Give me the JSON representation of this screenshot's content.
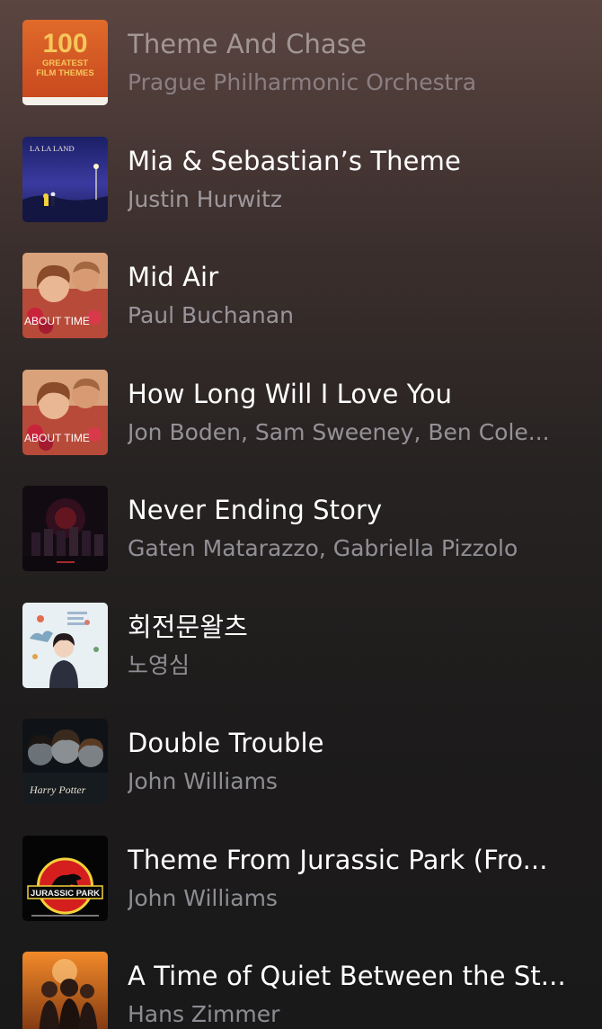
{
  "songs": [
    {
      "title": "Theme And Chase",
      "artist": "Prague Philharmonic Orchestra",
      "art": "100-greatest-film-themes-cover",
      "art_text": [
        "100",
        "GREATEST",
        "FILM THEMES"
      ],
      "dimmed": true
    },
    {
      "title": "Mia & Sebastian’s Theme",
      "artist": "Justin Hurwitz",
      "art": "la-la-land-cover",
      "art_text": [
        "LA LA LAND"
      ],
      "dimmed": false
    },
    {
      "title": "Mid Air",
      "artist": "Paul Buchanan",
      "art": "about-time-cover",
      "art_text": [
        "ABOUT TIME"
      ],
      "dimmed": false
    },
    {
      "title": "How Long Will I Love You",
      "artist": "Jon Boden, Sam Sweeney, Ben Cole...",
      "art": "about-time-cover",
      "art_text": [
        "ABOUT TIME"
      ],
      "dimmed": false
    },
    {
      "title": "Never Ending Story",
      "artist": "Gaten Matarazzo, Gabriella Pizzolo",
      "art": "stranger-things-cover",
      "art_text": [],
      "dimmed": false
    },
    {
      "title": "회전문왈츠",
      "artist": "노영심",
      "art": "korean-drama-ost-cover",
      "art_text": [],
      "dimmed": false
    },
    {
      "title": "Double Trouble",
      "artist": "John Williams",
      "art": "harry-potter-cover",
      "art_text": [
        "Harry Potter"
      ],
      "dimmed": false
    },
    {
      "title": "Theme From Jurassic Park (Fro...",
      "artist": "John Williams",
      "art": "jurassic-park-cover",
      "art_text": [
        "JURASSIC PARK"
      ],
      "dimmed": false
    },
    {
      "title": "A Time of Quiet Between the St...",
      "artist": "Hans Zimmer",
      "art": "dune-cover",
      "art_text": [],
      "dimmed": false
    }
  ],
  "colors": {
    "background_top": "#5b4541",
    "background_bottom": "#1a1919",
    "title": "#ffffff",
    "artist": "#a4a3a8"
  }
}
